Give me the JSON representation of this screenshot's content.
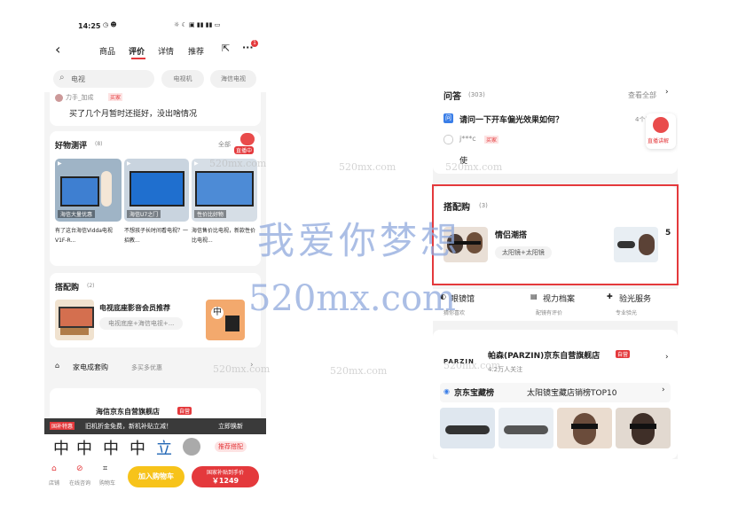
{
  "left": {
    "status_time": "14:25",
    "nav": {
      "tabs": [
        "商品",
        "评价",
        "详情",
        "推荐"
      ],
      "active_tab": "评价",
      "cart_badge": "1"
    },
    "search": {
      "placeholder": "电视",
      "chips": [
        "电视机",
        "海信电视"
      ]
    },
    "review": {
      "user": "力手_加成",
      "tag": "买家",
      "text": "买了几个月暂时还挺好，没出啥情况"
    },
    "good_reviews": {
      "title": "好物测评",
      "count": "(8)",
      "more": "全部",
      "live_label": "直播中",
      "items": [
        {
          "caption": "海信大量优惠",
          "text": "有了这台海信Vidda电视V1F-R..."
        },
        {
          "caption": "海信U7之门",
          "text": "不想孩子长时间看电视？一招教..."
        },
        {
          "caption": "性价比好物",
          "text": "海信售价比电视，新款性价比电视..."
        }
      ]
    },
    "bundle": {
      "title": "搭配购",
      "count": "(2)",
      "name": "电视底座影音会员推荐",
      "sub": "电视底座+海信电视+..."
    },
    "home_appliance": {
      "title": "家电成套购",
      "sub": "多买多优惠"
    },
    "store": {
      "name": "海信京东自营旗舰店",
      "tag": "自营"
    },
    "promo": {
      "tag": "国补特惠",
      "text": "旧机折金免费，新机补贴立减！",
      "action": "立即换新"
    },
    "reco_label": "推荐搭配",
    "bottom": {
      "icons": [
        "店铺",
        "在线咨询",
        "购物车"
      ],
      "add_cart": "加入购物车",
      "buy_label": "国家补贴到手价",
      "buy_price": "￥1249"
    }
  },
  "right": {
    "qa": {
      "title": "问答",
      "count": "(303)",
      "more": "查看全部",
      "question": "请问一下开车偏光效果如何？",
      "answer_count": "4个回答",
      "user": "j***c",
      "user_tag": "买家",
      "answer": "使",
      "live_label": "直播讲解"
    },
    "bundle": {
      "title": "搭配购",
      "count": "(3)",
      "name": "情侣潮搭",
      "sub": "太阳镜+太阳镜",
      "overflow": "5"
    },
    "services": [
      {
        "label": "眼镜馆",
        "sub": "猜你喜欢"
      },
      {
        "label": "视力档案",
        "sub": "配镜有评价"
      },
      {
        "label": "验光服务",
        "sub": "专业验光"
      }
    ],
    "store": {
      "logo": "PARZIN",
      "name": "帕森(PARZIN)京东自营旗舰店",
      "tag": "自营",
      "followers": "4.2万人关注"
    },
    "ranking": {
      "badge": "京东宝藏榜",
      "title": "太阳镜宝藏店销榜TOP10"
    }
  },
  "watermarks": {
    "chinese": "我爱你梦想",
    "domain": "520mx.com",
    "small": "520mx.com"
  }
}
